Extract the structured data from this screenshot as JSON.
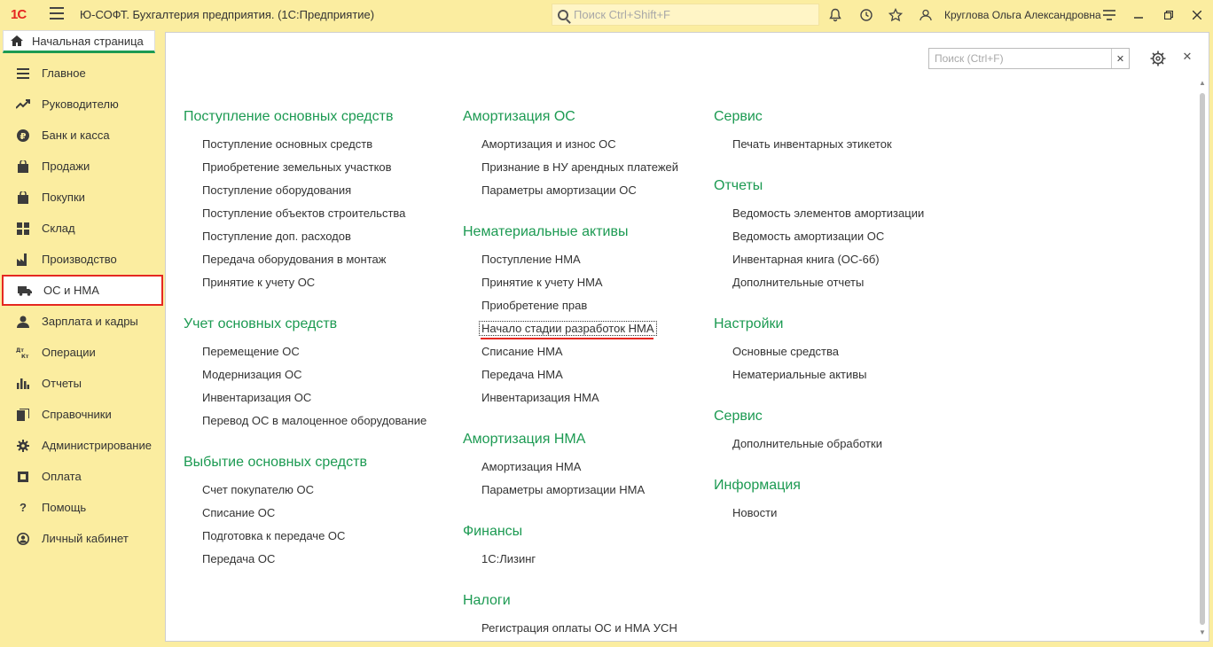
{
  "titlebar": {
    "logo": "1С",
    "title": "Ю-СОФТ. Бухгалтерия предприятия.  (1С:Предприятие)",
    "search_placeholder": "Поиск Ctrl+Shift+F",
    "user": "Круглова Ольга Александровна"
  },
  "home_tab": {
    "label": "Начальная страница"
  },
  "sidebar": {
    "items": [
      {
        "label": "Главное",
        "icon": "menu-icon"
      },
      {
        "label": "Руководителю",
        "icon": "trend-icon"
      },
      {
        "label": "Банк и касса",
        "icon": "coin-icon"
      },
      {
        "label": "Продажи",
        "icon": "shopping-bag-icon"
      },
      {
        "label": "Покупки",
        "icon": "cart-icon"
      },
      {
        "label": "Склад",
        "icon": "warehouse-icon"
      },
      {
        "label": "Производство",
        "icon": "factory-icon"
      },
      {
        "label": "ОС и НМА",
        "icon": "truck-icon"
      },
      {
        "label": "Зарплата и кадры",
        "icon": "person-icon"
      },
      {
        "label": "Операции",
        "icon": "dt-kt-icon"
      },
      {
        "label": "Отчеты",
        "icon": "bar-chart-icon"
      },
      {
        "label": "Справочники",
        "icon": "books-icon"
      },
      {
        "label": "Администрирование",
        "icon": "gear-icon"
      },
      {
        "label": "Оплата",
        "icon": "wallet-icon"
      },
      {
        "label": "Помощь",
        "icon": "question-icon"
      },
      {
        "label": "Личный кабинет",
        "icon": "user-circle-icon"
      }
    ]
  },
  "main": {
    "search_placeholder": "Поиск (Ctrl+F)",
    "col1": [
      {
        "title": "Поступление основных средств",
        "links": [
          "Поступление основных средств",
          "Приобретение земельных участков",
          "Поступление оборудования",
          "Поступление объектов строительства",
          "Поступление доп. расходов",
          "Передача оборудования в монтаж",
          "Принятие к учету ОС"
        ]
      },
      {
        "title": "Учет основных средств",
        "links": [
          "Перемещение ОС",
          "Модернизация ОС",
          "Инвентаризация ОС",
          "Перевод ОС в малоценное оборудование"
        ]
      },
      {
        "title": "Выбытие основных средств",
        "links": [
          "Счет покупателю ОС",
          "Списание ОС",
          "Подготовка к передаче ОС",
          "Передача ОС"
        ]
      }
    ],
    "col2": [
      {
        "title": "Амортизация ОС",
        "links": [
          "Амортизация и износ ОС",
          "Признание в НУ арендных платежей",
          "Параметры амортизации ОС"
        ]
      },
      {
        "title": "Нематериальные активы",
        "links": [
          "Поступление НМА",
          "Принятие к учету НМА",
          "Приобретение прав",
          "Начало стадии разработок НМА",
          "Списание НМА",
          "Передача НМА",
          "Инвентаризация НМА"
        ]
      },
      {
        "title": "Амортизация НМА",
        "links": [
          "Амортизация НМА",
          "Параметры амортизации НМА"
        ]
      },
      {
        "title": "Финансы",
        "links": [
          "1С:Лизинг"
        ]
      },
      {
        "title": "Налоги",
        "links": [
          "Регистрация оплаты ОС и НМА УСН"
        ]
      }
    ],
    "col3": [
      {
        "title": "Сервис",
        "links": [
          "Печать инвентарных этикеток"
        ]
      },
      {
        "title": "Отчеты",
        "links": [
          "Ведомость элементов амортизации",
          "Ведомость амортизации ОС",
          "Инвентарная книга (ОС-6б)",
          "Дополнительные отчеты"
        ]
      },
      {
        "title": "Настройки",
        "links": [
          "Основные средства",
          "Нематериальные активы"
        ]
      },
      {
        "title": "Сервис",
        "links": [
          "Дополнительные обработки"
        ]
      },
      {
        "title": "Информация",
        "links": [
          "Новости"
        ]
      }
    ]
  }
}
